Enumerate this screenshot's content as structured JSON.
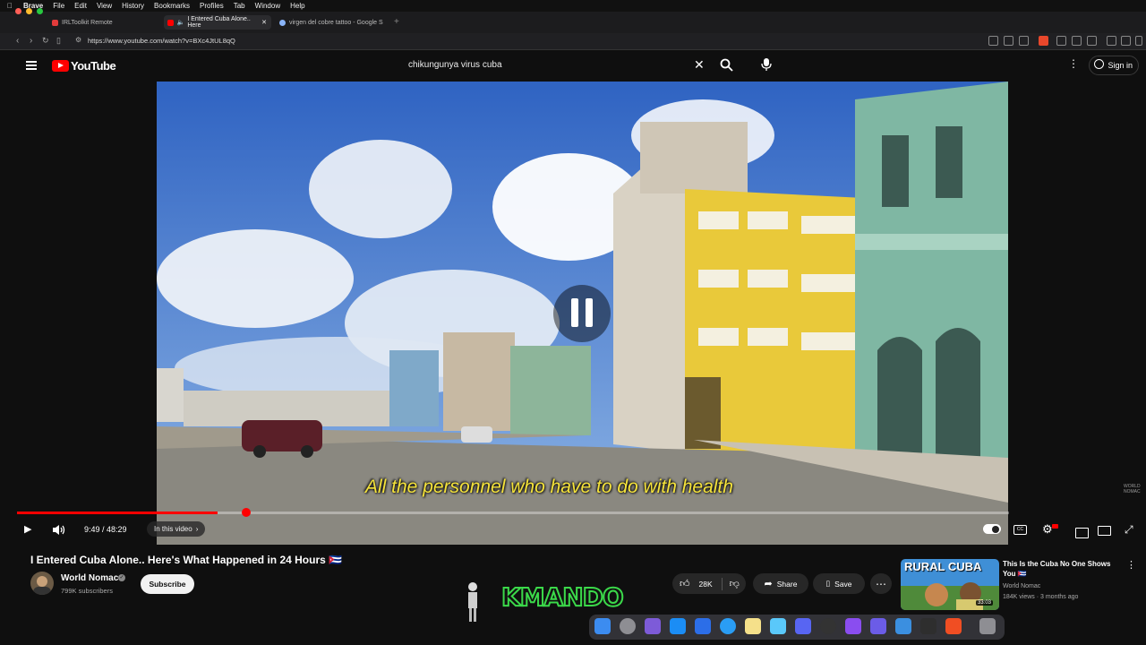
{
  "menubar": {
    "apple": "",
    "items": [
      "Brave",
      "File",
      "Edit",
      "View",
      "History",
      "Bookmarks",
      "Profiles",
      "Tab",
      "Window",
      "Help"
    ]
  },
  "tabs": [
    {
      "label": "IRLToolkit Remote",
      "favicon_color": "#e23b3b"
    },
    {
      "label": "I Entered Cuba Alone.. Here",
      "favicon_color": "#ff0000"
    },
    {
      "label": "virgen del cobre tattoo - Google S",
      "favicon_color": "#8ab4f8"
    }
  ],
  "address": {
    "url": "https://www.youtube.com/watch?v=BXc4JtUL8qQ"
  },
  "youtube": {
    "logo": "YouTube",
    "search_value": "chikungunya virus cuba",
    "sign_in": "Sign in"
  },
  "player": {
    "subtitle": "All the personnel who have to do with health",
    "time": "9:49 / 48:29",
    "in_this_video": "In this video",
    "progress": 0.2025
  },
  "video_info": {
    "title": "I Entered Cuba Alone.. Here's What Happened in 24 Hours 🇨🇺",
    "channel": "World Nomac",
    "subscribers": "799K subscribers",
    "subscribe": "Subscribe",
    "likes": "28K",
    "share": "Share",
    "save": "Save"
  },
  "recommended": {
    "thumb_text": "RURAL CUBA",
    "title": "This Is the Cuba No One Shows You 🇨🇺",
    "channel": "World Nomac",
    "views": "184K views · 3 months ago",
    "duration": "33:03"
  },
  "overlay": {
    "logo": "KMANDO",
    "watermark_1": "WORLD",
    "watermark_2": "NOMAC"
  },
  "colors": {
    "accent": "#ff0000",
    "subtitle": "#f5e33b",
    "bg": "#0f0f0f"
  }
}
